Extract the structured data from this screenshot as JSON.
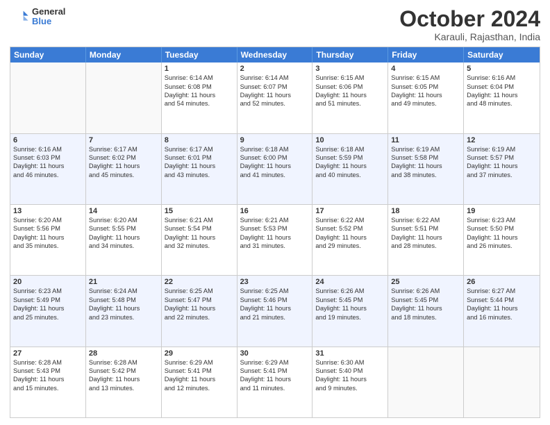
{
  "header": {
    "logo_general": "General",
    "logo_blue": "Blue",
    "month": "October 2024",
    "location": "Karauli, Rajasthan, India"
  },
  "days_of_week": [
    "Sunday",
    "Monday",
    "Tuesday",
    "Wednesday",
    "Thursday",
    "Friday",
    "Saturday"
  ],
  "rows": [
    {
      "alt": false,
      "cells": [
        {
          "day": "",
          "lines": []
        },
        {
          "day": "",
          "lines": []
        },
        {
          "day": "1",
          "lines": [
            "Sunrise: 6:14 AM",
            "Sunset: 6:08 PM",
            "Daylight: 11 hours",
            "and 54 minutes."
          ]
        },
        {
          "day": "2",
          "lines": [
            "Sunrise: 6:14 AM",
            "Sunset: 6:07 PM",
            "Daylight: 11 hours",
            "and 52 minutes."
          ]
        },
        {
          "day": "3",
          "lines": [
            "Sunrise: 6:15 AM",
            "Sunset: 6:06 PM",
            "Daylight: 11 hours",
            "and 51 minutes."
          ]
        },
        {
          "day": "4",
          "lines": [
            "Sunrise: 6:15 AM",
            "Sunset: 6:05 PM",
            "Daylight: 11 hours",
            "and 49 minutes."
          ]
        },
        {
          "day": "5",
          "lines": [
            "Sunrise: 6:16 AM",
            "Sunset: 6:04 PM",
            "Daylight: 11 hours",
            "and 48 minutes."
          ]
        }
      ]
    },
    {
      "alt": true,
      "cells": [
        {
          "day": "6",
          "lines": [
            "Sunrise: 6:16 AM",
            "Sunset: 6:03 PM",
            "Daylight: 11 hours",
            "and 46 minutes."
          ]
        },
        {
          "day": "7",
          "lines": [
            "Sunrise: 6:17 AM",
            "Sunset: 6:02 PM",
            "Daylight: 11 hours",
            "and 45 minutes."
          ]
        },
        {
          "day": "8",
          "lines": [
            "Sunrise: 6:17 AM",
            "Sunset: 6:01 PM",
            "Daylight: 11 hours",
            "and 43 minutes."
          ]
        },
        {
          "day": "9",
          "lines": [
            "Sunrise: 6:18 AM",
            "Sunset: 6:00 PM",
            "Daylight: 11 hours",
            "and 41 minutes."
          ]
        },
        {
          "day": "10",
          "lines": [
            "Sunrise: 6:18 AM",
            "Sunset: 5:59 PM",
            "Daylight: 11 hours",
            "and 40 minutes."
          ]
        },
        {
          "day": "11",
          "lines": [
            "Sunrise: 6:19 AM",
            "Sunset: 5:58 PM",
            "Daylight: 11 hours",
            "and 38 minutes."
          ]
        },
        {
          "day": "12",
          "lines": [
            "Sunrise: 6:19 AM",
            "Sunset: 5:57 PM",
            "Daylight: 11 hours",
            "and 37 minutes."
          ]
        }
      ]
    },
    {
      "alt": false,
      "cells": [
        {
          "day": "13",
          "lines": [
            "Sunrise: 6:20 AM",
            "Sunset: 5:56 PM",
            "Daylight: 11 hours",
            "and 35 minutes."
          ]
        },
        {
          "day": "14",
          "lines": [
            "Sunrise: 6:20 AM",
            "Sunset: 5:55 PM",
            "Daylight: 11 hours",
            "and 34 minutes."
          ]
        },
        {
          "day": "15",
          "lines": [
            "Sunrise: 6:21 AM",
            "Sunset: 5:54 PM",
            "Daylight: 11 hours",
            "and 32 minutes."
          ]
        },
        {
          "day": "16",
          "lines": [
            "Sunrise: 6:21 AM",
            "Sunset: 5:53 PM",
            "Daylight: 11 hours",
            "and 31 minutes."
          ]
        },
        {
          "day": "17",
          "lines": [
            "Sunrise: 6:22 AM",
            "Sunset: 5:52 PM",
            "Daylight: 11 hours",
            "and 29 minutes."
          ]
        },
        {
          "day": "18",
          "lines": [
            "Sunrise: 6:22 AM",
            "Sunset: 5:51 PM",
            "Daylight: 11 hours",
            "and 28 minutes."
          ]
        },
        {
          "day": "19",
          "lines": [
            "Sunrise: 6:23 AM",
            "Sunset: 5:50 PM",
            "Daylight: 11 hours",
            "and 26 minutes."
          ]
        }
      ]
    },
    {
      "alt": true,
      "cells": [
        {
          "day": "20",
          "lines": [
            "Sunrise: 6:23 AM",
            "Sunset: 5:49 PM",
            "Daylight: 11 hours",
            "and 25 minutes."
          ]
        },
        {
          "day": "21",
          "lines": [
            "Sunrise: 6:24 AM",
            "Sunset: 5:48 PM",
            "Daylight: 11 hours",
            "and 23 minutes."
          ]
        },
        {
          "day": "22",
          "lines": [
            "Sunrise: 6:25 AM",
            "Sunset: 5:47 PM",
            "Daylight: 11 hours",
            "and 22 minutes."
          ]
        },
        {
          "day": "23",
          "lines": [
            "Sunrise: 6:25 AM",
            "Sunset: 5:46 PM",
            "Daylight: 11 hours",
            "and 21 minutes."
          ]
        },
        {
          "day": "24",
          "lines": [
            "Sunrise: 6:26 AM",
            "Sunset: 5:45 PM",
            "Daylight: 11 hours",
            "and 19 minutes."
          ]
        },
        {
          "day": "25",
          "lines": [
            "Sunrise: 6:26 AM",
            "Sunset: 5:45 PM",
            "Daylight: 11 hours",
            "and 18 minutes."
          ]
        },
        {
          "day": "26",
          "lines": [
            "Sunrise: 6:27 AM",
            "Sunset: 5:44 PM",
            "Daylight: 11 hours",
            "and 16 minutes."
          ]
        }
      ]
    },
    {
      "alt": false,
      "cells": [
        {
          "day": "27",
          "lines": [
            "Sunrise: 6:28 AM",
            "Sunset: 5:43 PM",
            "Daylight: 11 hours",
            "and 15 minutes."
          ]
        },
        {
          "day": "28",
          "lines": [
            "Sunrise: 6:28 AM",
            "Sunset: 5:42 PM",
            "Daylight: 11 hours",
            "and 13 minutes."
          ]
        },
        {
          "day": "29",
          "lines": [
            "Sunrise: 6:29 AM",
            "Sunset: 5:41 PM",
            "Daylight: 11 hours",
            "and 12 minutes."
          ]
        },
        {
          "day": "30",
          "lines": [
            "Sunrise: 6:29 AM",
            "Sunset: 5:41 PM",
            "Daylight: 11 hours",
            "and 11 minutes."
          ]
        },
        {
          "day": "31",
          "lines": [
            "Sunrise: 6:30 AM",
            "Sunset: 5:40 PM",
            "Daylight: 11 hours",
            "and 9 minutes."
          ]
        },
        {
          "day": "",
          "lines": []
        },
        {
          "day": "",
          "lines": []
        }
      ]
    }
  ]
}
